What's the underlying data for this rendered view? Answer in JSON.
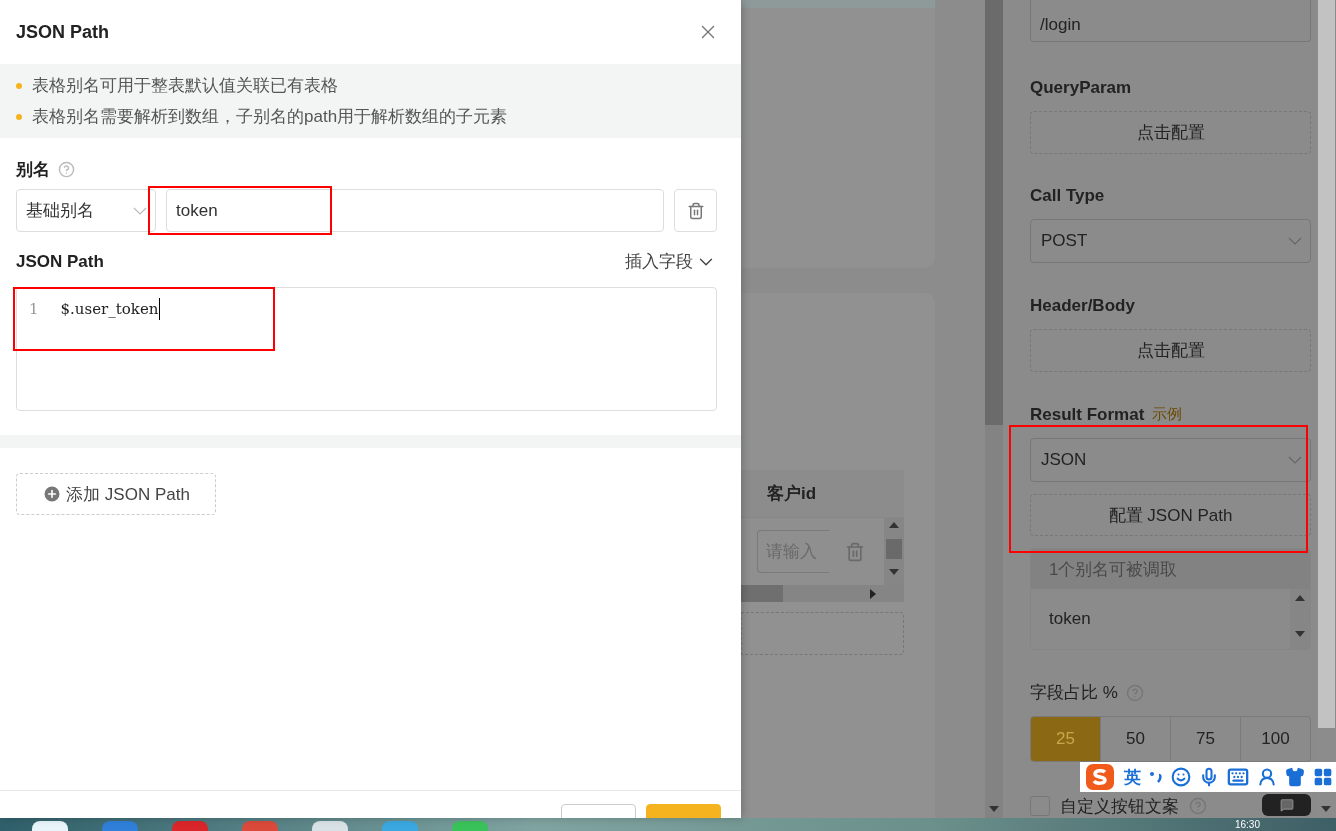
{
  "drawer": {
    "title": "JSON Path",
    "notes": [
      "表格别名可用于整表默认值关联已有表格",
      "表格别名需要解析到数组，子别名的path用于解析数组的子元素"
    ],
    "alias_label": "别名",
    "alias_rows": [
      {
        "type": "基础别名",
        "name": "token"
      }
    ],
    "path_label": "JSON Path",
    "insert_field": "插入字段",
    "editor": {
      "line_numbers": [
        "1"
      ],
      "code": "$.user_token"
    },
    "add_button": "添加 JSON Path"
  },
  "background": {
    "table": {
      "columns": [
        "客户id"
      ],
      "input_placeholder": "请输入"
    },
    "settings": {
      "url_tail": "/login",
      "sections": [
        {
          "kind": "button",
          "label": "QueryParam",
          "value": "点击配置"
        },
        {
          "kind": "select",
          "label": "Call Type",
          "value": "POST"
        },
        {
          "kind": "button",
          "label": "Header/Body",
          "value": "点击配置"
        }
      ],
      "result_format": {
        "label": "Result Format",
        "example_link": "示例",
        "value": "JSON",
        "button": "配置 JSON Path",
        "alias_count": "1个别名可被调取",
        "aliases": [
          "token"
        ]
      },
      "ratio": {
        "label": "字段占比 %",
        "options": [
          {
            "label": "25",
            "selected": true
          },
          {
            "label": "50",
            "selected": false
          },
          {
            "label": "75",
            "selected": false
          },
          {
            "label": "100",
            "selected": false
          }
        ]
      },
      "custom_text": {
        "label": "自定义按钮文案",
        "checked": false
      }
    }
  },
  "ime": {
    "mode": "英"
  },
  "taskbar": {
    "clock": "16:30"
  }
}
